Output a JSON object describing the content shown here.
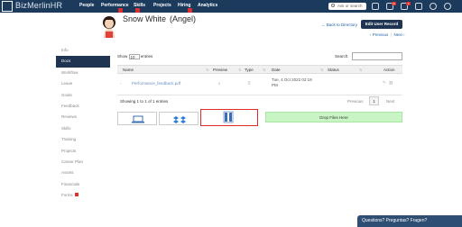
{
  "topbar": {
    "logo_text": "BizMerlinHR",
    "nav": [
      "People",
      "Performance",
      "Skills",
      "Projects",
      "Hiring",
      "Analytics"
    ],
    "search_placeholder": "Ask or search",
    "badges": [
      "12",
      "3"
    ]
  },
  "header": {
    "name": "Snow White",
    "alias": "(Angel)",
    "back_link": "← Back to Directory",
    "edit_button": "Edit User Record",
    "pager_prev": "‹ Previous",
    "pager_next": "Next ›"
  },
  "sidebar": {
    "items": [
      "Info",
      "Docs",
      "Workflow",
      "Leave",
      "Goals",
      "Feedback",
      "Reviews",
      "Skills",
      "Training",
      "Projects",
      "Career Plan",
      "Assets",
      "Financials",
      "Forms"
    ],
    "active_index": 1
  },
  "table": {
    "show_label": "Show",
    "entries_value": "10",
    "entries_label": "entries",
    "search_label": "Search:",
    "columns": [
      "Name",
      "Preview",
      "Type",
      "Date",
      "Status",
      "Action"
    ],
    "rows": [
      {
        "name": "Performance_feedback.pdf",
        "date_line1": "Tue, 4 Oct 2022 02:19",
        "date_line2": "PM"
      }
    ],
    "showing": "Showing 1 to 1 of 1 entries",
    "prev": "Previous",
    "page": "1",
    "next": "Next"
  },
  "upload": {
    "dropzone_label": "Drop Files Here"
  },
  "help": {
    "label": "Questions? Preguntas? Fragen?"
  },
  "colors": {
    "topbar": "#1c3a5c",
    "active": "#1e3451",
    "link": "#1f5fa8",
    "dropzone": "#c9f5c5",
    "highlight": "#e02a2a"
  }
}
